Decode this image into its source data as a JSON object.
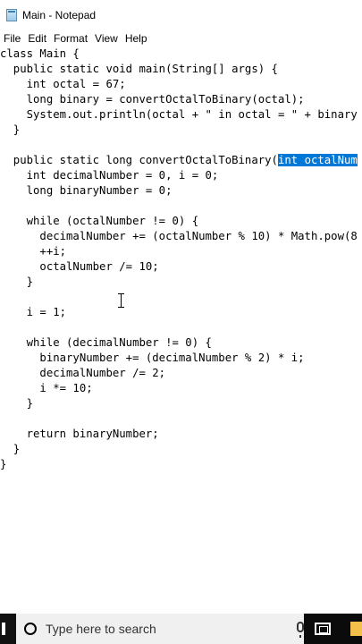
{
  "window": {
    "title": "Main - Notepad"
  },
  "menu": [
    "File",
    "Edit",
    "Format",
    "View",
    "Help"
  ],
  "code_lines": [
    "class Main {",
    "  public static void main(String[] args) {",
    "    int octal = 67;",
    "    long binary = convertOctalToBinary(octal);",
    "    System.out.println(octal + \" in octal = \" + binary",
    "  }",
    "",
    "  public static long convertOctalToBinary(",
    "    int decimalNumber = 0, i = 0;",
    "    long binaryNumber = 0;",
    "",
    "    while (octalNumber != 0) {",
    "      decimalNumber += (octalNumber % 10) * Math.pow(8",
    "      ++i;",
    "      octalNumber /= 10;",
    "    }",
    "",
    "    i = 1;",
    "",
    "    while (decimalNumber != 0) {",
    "      binaryNumber += (decimalNumber % 2) * i;",
    "      decimalNumber /= 2;",
    "      i *= 10;",
    "    }",
    "",
    "    return binaryNumber;",
    "  }",
    "}"
  ],
  "selection": {
    "line_index": 7,
    "text": "int octalNum"
  },
  "taskbar": {
    "search_placeholder": "Type here to search"
  },
  "colors": {
    "selection": "#0078d7",
    "taskbar": "#0b0b0b"
  }
}
